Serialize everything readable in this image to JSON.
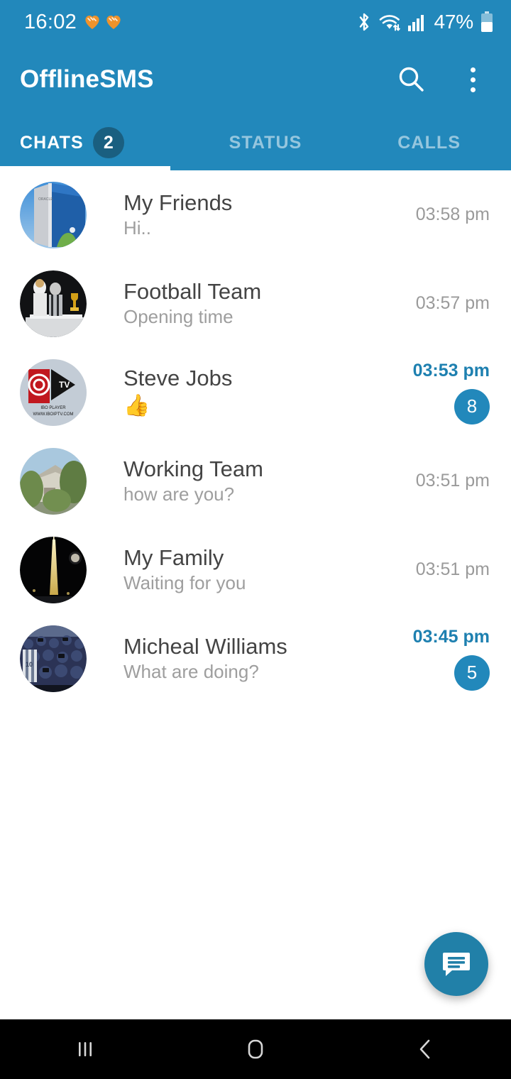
{
  "status_bar": {
    "clock": "16:02",
    "icons": [
      "heart-emoji",
      "heart-emoji",
      "bluetooth-icon",
      "wifi-icon",
      "cellular-signal-icon"
    ],
    "battery_percent": "47%"
  },
  "toolbar": {
    "app_title": "OfflineSMS",
    "search_icon": "search-icon",
    "overflow_icon": "more-vertical-icon"
  },
  "tabs": {
    "active_index": 0,
    "items": [
      {
        "label": "CHATS",
        "badge": "2"
      },
      {
        "label": "STATUS",
        "badge": ""
      },
      {
        "label": "CALLS",
        "badge": ""
      }
    ]
  },
  "chats": [
    {
      "name": "My Friends",
      "message": "Hi..",
      "time": "03:58 pm",
      "unread": "",
      "highlight": false,
      "avatar": "office-building-photo"
    },
    {
      "name": "Football Team",
      "message": "Opening time",
      "time": "03:57 pm",
      "unread": "",
      "highlight": false,
      "avatar": "trophy-ceremony-photo"
    },
    {
      "name": "Steve Jobs",
      "message": "👍",
      "time": "03:53 pm",
      "unread": "8",
      "highlight": true,
      "avatar": "ibo-player-tv-logo"
    },
    {
      "name": "Working Team",
      "message": "how are you?",
      "time": "03:51 pm",
      "unread": "",
      "highlight": false,
      "avatar": "house-with-trees-photo"
    },
    {
      "name": "My Family",
      "message": "Waiting for you",
      "time": "03:51 pm",
      "unread": "",
      "highlight": false,
      "avatar": "night-skyscraper-photo"
    },
    {
      "name": "Micheal Williams",
      "message": "What are doing?",
      "time": "03:45 pm",
      "unread": "5",
      "highlight": true,
      "avatar": "stadium-crowd-photo"
    }
  ],
  "fab": {
    "icon": "new-message-icon"
  },
  "nav_bar": {
    "recents_icon": "recents-icon",
    "home_icon": "home-icon",
    "back_icon": "back-icon"
  },
  "colors": {
    "primary": "#2288bb",
    "tab_badge": "#1a5f80",
    "accent": "#1e80b0",
    "unread_badge": "#2288bb",
    "fab": "#2180a8",
    "title_text": "#444444",
    "subtitle_text": "#9e9e9e",
    "nav_bar": "#000000"
  }
}
